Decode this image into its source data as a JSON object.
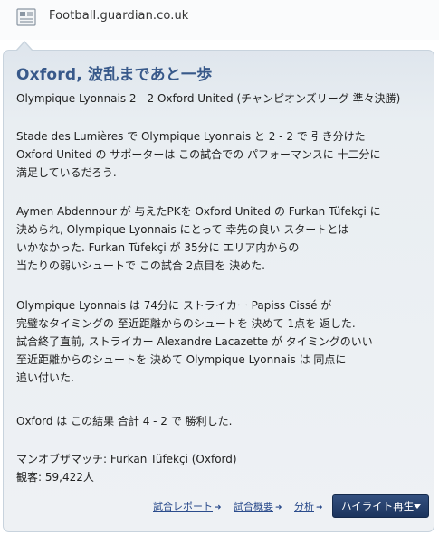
{
  "source": {
    "icon": "newspaper-icon",
    "name": "Football.guardian.co.uk"
  },
  "article": {
    "headline": "Oxford, 波乱まであと一歩",
    "subtitle": "Olympique Lyonnais 2 - 2 Oxford United (チャンピオンズリーグ 準々決勝)",
    "paragraphs": [
      [
        "Stade des Lumières で Olympique Lyonnais と 2 - 2 で 引き分けた",
        "Oxford United の サポーターは この試合での パフォーマンスに 十二分に",
        "満足しているだろう."
      ],
      [
        "Aymen Abdennour が 与えたPKを Oxford United の Furkan Tüfekçi に",
        "決められ, Olympique Lyonnais にとって 幸先の良い スタートとは",
        "いかなかった. Furkan Tüfekçi が 35分に エリア内からの",
        "当たりの弱いシュートで この試合 2点目を 決めた."
      ],
      [
        "Olympique Lyonnais は 74分に ストライカー Papiss Cissé が",
        "完璧なタイミングの 至近距離からのシュートを 決めて 1点を 返した.",
        "試合終了直前, ストライカー Alexandre Lacazette が タイミングのいい",
        "至近距離からのシュートを 決めて Olympique Lyonnais は 同点に",
        "追い付いた."
      ],
      [
        "Oxford は この結果 合計 4 - 2 で 勝利した."
      ],
      [
        "マンオブザマッチ: Furkan Tüfekçi (Oxford)",
        "観客: 59,422人"
      ]
    ]
  },
  "footer": {
    "links": [
      {
        "label": "試合レポート",
        "icon": "arrow-right-icon"
      },
      {
        "label": "試合概要",
        "icon": "arrow-right-icon"
      },
      {
        "label": "分析",
        "icon": "arrow-right-icon"
      }
    ],
    "button_label": "ハイライト再生",
    "button_icon": "caret-down-icon"
  },
  "colors": {
    "headline": "#38598a",
    "panel_background": "#e9eef2",
    "panel_border": "#c8d3dd",
    "button": "#1c345d",
    "link": "#2b4c8c"
  }
}
